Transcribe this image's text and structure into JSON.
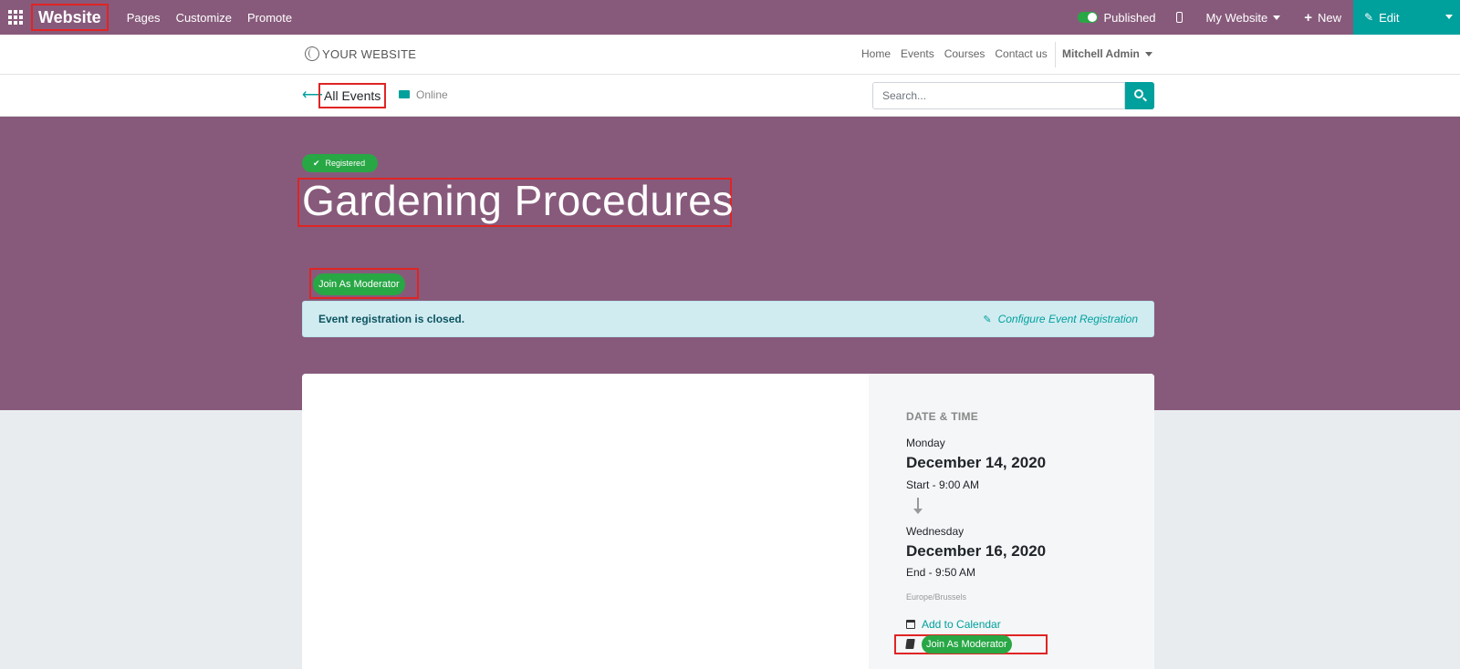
{
  "admin_bar": {
    "brand": "Website",
    "menu": [
      "Pages",
      "Customize",
      "Promote"
    ],
    "published_label": "Published",
    "my_website_label": "My Website",
    "new_label": "New",
    "edit_label": "Edit",
    "colors": {
      "bar": "#875a7b",
      "edit": "#00a09d",
      "toggle_on": "#28a745"
    }
  },
  "site_nav": {
    "logo_text": "YOUR WEBSITE",
    "links": [
      "Home",
      "Events",
      "Courses",
      "Contact us"
    ],
    "user": "Mitchell Admin"
  },
  "sub_nav": {
    "back_label": "All Events",
    "category": "Online",
    "search_placeholder": "Search..."
  },
  "event": {
    "badge": "Registered",
    "title": "Gardening Procedures",
    "moderator_button": "Join As Moderator",
    "alert_text": "Event registration is closed.",
    "configure_link": "Configure Event Registration"
  },
  "schedule": {
    "heading": "DATE & TIME",
    "start_day": "Monday",
    "start_date": "December 14, 2020",
    "start_time": "Start - 9:00 AM",
    "end_day": "Wednesday",
    "end_date": "December 16, 2020",
    "end_time": "End - 9:50 AM",
    "timezone": "Europe/Brussels",
    "add_calendar": "Add to Calendar",
    "moderator_button": "Join As Moderator"
  }
}
